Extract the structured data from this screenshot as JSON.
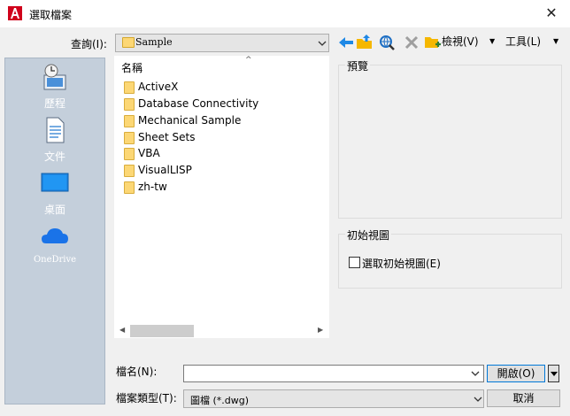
{
  "window": {
    "title": "選取檔案",
    "close_glyph": "✕"
  },
  "lookin": {
    "label": "查詢(I):",
    "value": "Sample"
  },
  "toolbar": {
    "icons": [
      "back-arrow-icon",
      "up-folder-icon",
      "search-web-icon",
      "delete-icon",
      "new-folder-icon"
    ],
    "views_label": "檢視(V)",
    "tools_label": "工具(L)",
    "dropdown_glyph": "▼"
  },
  "places": [
    {
      "label": "歷程",
      "icon": "history-icon"
    },
    {
      "label": "文件",
      "icon": "documents-icon"
    },
    {
      "label": "桌面",
      "icon": "desktop-icon"
    },
    {
      "label": "OneDrive",
      "icon": "onedrive-icon"
    }
  ],
  "filelist": {
    "column_header": "名稱",
    "sort_glyph": "^",
    "items": [
      "ActiveX",
      "Database Connectivity",
      "Mechanical Sample",
      "Sheet Sets",
      "VBA",
      "VisualLISP",
      "zh-tw"
    ],
    "scroll_left_glyph": "◀",
    "scroll_right_glyph": "▶"
  },
  "preview": {
    "label": "預覽"
  },
  "initial_view": {
    "label": "初始視圖",
    "checkbox_label": "選取初始視圖(E)",
    "checked": false
  },
  "form": {
    "filename_label": "檔名(N):",
    "filename_value": "",
    "filetype_label": "檔案類型(T):",
    "filetype_value": "圖檔 (*.dwg)",
    "open_label": "開啟(O)",
    "cancel_label": "取消"
  },
  "colors": {
    "accent": "#0078d7",
    "places_bg": "#c4cfdb",
    "folder": "#fcd775",
    "app_red": "#d0021b"
  }
}
